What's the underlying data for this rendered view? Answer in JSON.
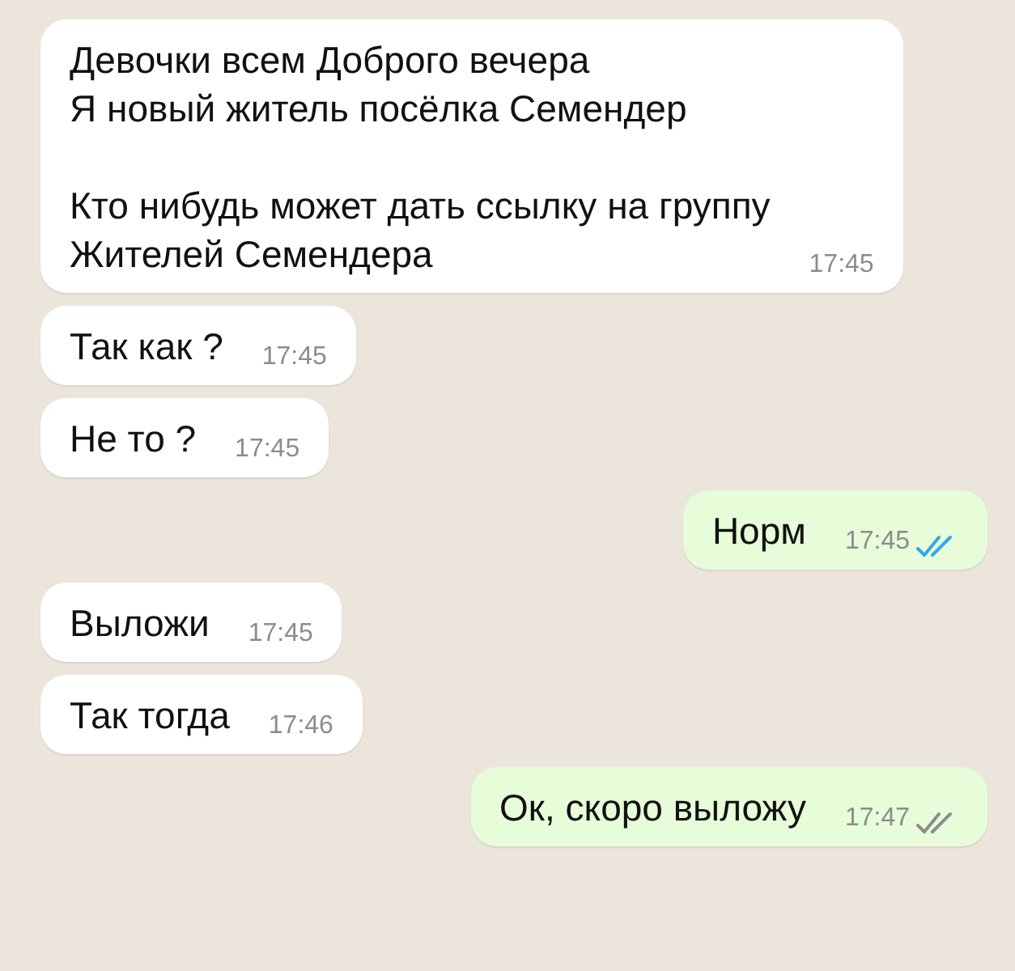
{
  "messages": [
    {
      "kind": "incoming",
      "text": "Девочки всем Доброго вечера\nЯ новый житель посёлка Семендер\n\nКто нибудь может дать ссылку на группу\nЖителей Семендера",
      "time": "17:45"
    },
    {
      "kind": "incoming",
      "text": "Так как ?",
      "time": "17:45"
    },
    {
      "kind": "incoming",
      "text": "Не то ?",
      "time": "17:45"
    },
    {
      "kind": "outgoing",
      "text": "Норм",
      "time": "17:45",
      "read": true
    },
    {
      "kind": "incoming",
      "text": "Выложи",
      "time": "17:45"
    },
    {
      "kind": "incoming",
      "text": "Так тогда",
      "time": "17:46"
    },
    {
      "kind": "outgoing",
      "text": "Ок, скоро выложу",
      "time": "17:47",
      "read": false
    }
  ]
}
